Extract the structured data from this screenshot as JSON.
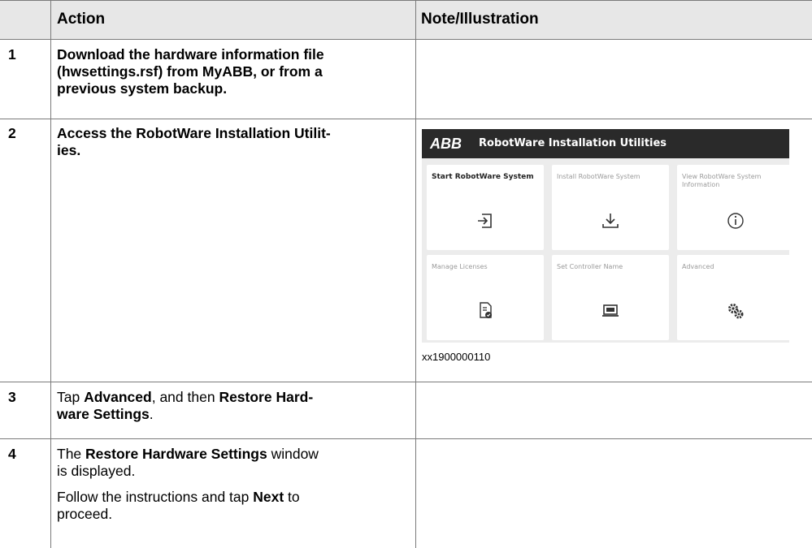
{
  "table": {
    "headers": {
      "col_num": "",
      "action": "Action",
      "note": "Note/Illustration"
    },
    "rows": [
      {
        "num": "1",
        "action_lines": [
          "Download the hardware information file",
          "(hwsettings.rsf) from MyABB, or from a",
          "previous system backup."
        ]
      },
      {
        "num": "2",
        "action_lines": [
          "Access the RobotWare Installation Utilit-",
          "ies."
        ]
      },
      {
        "num": "3",
        "action_line1": {
          "pre": "Tap ",
          "bold1": "Advanced",
          "mid": ", and then ",
          "bold2": "Restore Hard-"
        },
        "action_line2": {
          "bold": "ware Settings",
          "post": "."
        }
      },
      {
        "num": "4",
        "para1_line1": {
          "pre": "The ",
          "bold": "Restore Hardware Settings",
          "post": " window"
        },
        "para1_line2": "is displayed.",
        "para2_line1": {
          "pre": "Follow the instructions and tap ",
          "bold": "Next",
          "post": " to"
        },
        "para2_line2": "proceed."
      }
    ]
  },
  "illustration": {
    "logo": "ABB",
    "title": "RobotWare Installation Utilities",
    "tiles": [
      {
        "label": "Start RobotWare System",
        "icon": "sign-in-icon",
        "emphasis": true
      },
      {
        "label": "Install RobotWare System",
        "icon": "download-icon",
        "emphasis": false
      },
      {
        "label": "View RobotWare System Information",
        "icon": "info-icon",
        "emphasis": false
      },
      {
        "label": "Manage Licenses",
        "icon": "license-icon",
        "emphasis": false
      },
      {
        "label": "Set Controller Name",
        "icon": "controller-icon",
        "emphasis": false
      },
      {
        "label": "Advanced",
        "icon": "gears-icon",
        "emphasis": false
      }
    ],
    "caption": "xx1900000110"
  }
}
